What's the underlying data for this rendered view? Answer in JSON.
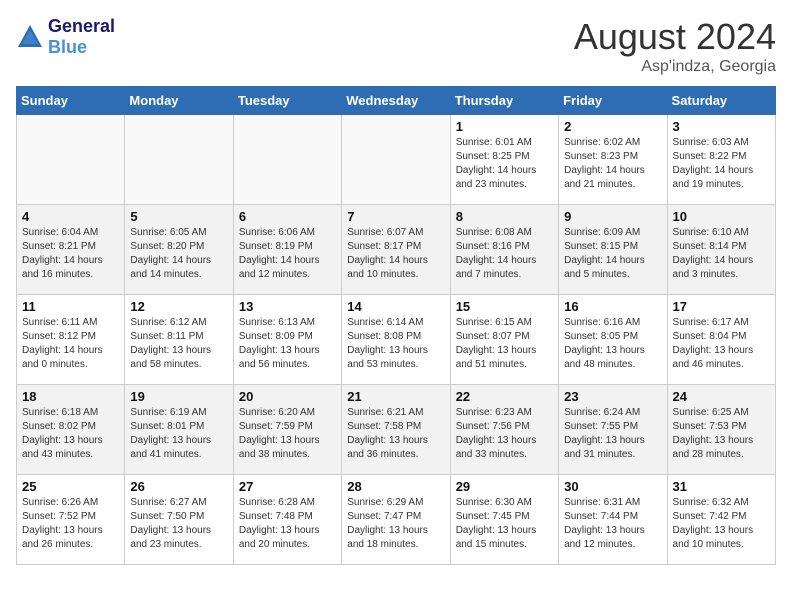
{
  "header": {
    "logo_general": "General",
    "logo_blue": "Blue",
    "month_year": "August 2024",
    "location": "Asp'indza, Georgia"
  },
  "days_of_week": [
    "Sunday",
    "Monday",
    "Tuesday",
    "Wednesday",
    "Thursday",
    "Friday",
    "Saturday"
  ],
  "weeks": [
    [
      {
        "day": "",
        "text": ""
      },
      {
        "day": "",
        "text": ""
      },
      {
        "day": "",
        "text": ""
      },
      {
        "day": "",
        "text": ""
      },
      {
        "day": "1",
        "text": "Sunrise: 6:01 AM\nSunset: 8:25 PM\nDaylight: 14 hours\nand 23 minutes."
      },
      {
        "day": "2",
        "text": "Sunrise: 6:02 AM\nSunset: 8:23 PM\nDaylight: 14 hours\nand 21 minutes."
      },
      {
        "day": "3",
        "text": "Sunrise: 6:03 AM\nSunset: 8:22 PM\nDaylight: 14 hours\nand 19 minutes."
      }
    ],
    [
      {
        "day": "4",
        "text": "Sunrise: 6:04 AM\nSunset: 8:21 PM\nDaylight: 14 hours\nand 16 minutes."
      },
      {
        "day": "5",
        "text": "Sunrise: 6:05 AM\nSunset: 8:20 PM\nDaylight: 14 hours\nand 14 minutes."
      },
      {
        "day": "6",
        "text": "Sunrise: 6:06 AM\nSunset: 8:19 PM\nDaylight: 14 hours\nand 12 minutes."
      },
      {
        "day": "7",
        "text": "Sunrise: 6:07 AM\nSunset: 8:17 PM\nDaylight: 14 hours\nand 10 minutes."
      },
      {
        "day": "8",
        "text": "Sunrise: 6:08 AM\nSunset: 8:16 PM\nDaylight: 14 hours\nand 7 minutes."
      },
      {
        "day": "9",
        "text": "Sunrise: 6:09 AM\nSunset: 8:15 PM\nDaylight: 14 hours\nand 5 minutes."
      },
      {
        "day": "10",
        "text": "Sunrise: 6:10 AM\nSunset: 8:14 PM\nDaylight: 14 hours\nand 3 minutes."
      }
    ],
    [
      {
        "day": "11",
        "text": "Sunrise: 6:11 AM\nSunset: 8:12 PM\nDaylight: 14 hours\nand 0 minutes."
      },
      {
        "day": "12",
        "text": "Sunrise: 6:12 AM\nSunset: 8:11 PM\nDaylight: 13 hours\nand 58 minutes."
      },
      {
        "day": "13",
        "text": "Sunrise: 6:13 AM\nSunset: 8:09 PM\nDaylight: 13 hours\nand 56 minutes."
      },
      {
        "day": "14",
        "text": "Sunrise: 6:14 AM\nSunset: 8:08 PM\nDaylight: 13 hours\nand 53 minutes."
      },
      {
        "day": "15",
        "text": "Sunrise: 6:15 AM\nSunset: 8:07 PM\nDaylight: 13 hours\nand 51 minutes."
      },
      {
        "day": "16",
        "text": "Sunrise: 6:16 AM\nSunset: 8:05 PM\nDaylight: 13 hours\nand 48 minutes."
      },
      {
        "day": "17",
        "text": "Sunrise: 6:17 AM\nSunset: 8:04 PM\nDaylight: 13 hours\nand 46 minutes."
      }
    ],
    [
      {
        "day": "18",
        "text": "Sunrise: 6:18 AM\nSunset: 8:02 PM\nDaylight: 13 hours\nand 43 minutes."
      },
      {
        "day": "19",
        "text": "Sunrise: 6:19 AM\nSunset: 8:01 PM\nDaylight: 13 hours\nand 41 minutes."
      },
      {
        "day": "20",
        "text": "Sunrise: 6:20 AM\nSunset: 7:59 PM\nDaylight: 13 hours\nand 38 minutes."
      },
      {
        "day": "21",
        "text": "Sunrise: 6:21 AM\nSunset: 7:58 PM\nDaylight: 13 hours\nand 36 minutes."
      },
      {
        "day": "22",
        "text": "Sunrise: 6:23 AM\nSunset: 7:56 PM\nDaylight: 13 hours\nand 33 minutes."
      },
      {
        "day": "23",
        "text": "Sunrise: 6:24 AM\nSunset: 7:55 PM\nDaylight: 13 hours\nand 31 minutes."
      },
      {
        "day": "24",
        "text": "Sunrise: 6:25 AM\nSunset: 7:53 PM\nDaylight: 13 hours\nand 28 minutes."
      }
    ],
    [
      {
        "day": "25",
        "text": "Sunrise: 6:26 AM\nSunset: 7:52 PM\nDaylight: 13 hours\nand 26 minutes."
      },
      {
        "day": "26",
        "text": "Sunrise: 6:27 AM\nSunset: 7:50 PM\nDaylight: 13 hours\nand 23 minutes."
      },
      {
        "day": "27",
        "text": "Sunrise: 6:28 AM\nSunset: 7:48 PM\nDaylight: 13 hours\nand 20 minutes."
      },
      {
        "day": "28",
        "text": "Sunrise: 6:29 AM\nSunset: 7:47 PM\nDaylight: 13 hours\nand 18 minutes."
      },
      {
        "day": "29",
        "text": "Sunrise: 6:30 AM\nSunset: 7:45 PM\nDaylight: 13 hours\nand 15 minutes."
      },
      {
        "day": "30",
        "text": "Sunrise: 6:31 AM\nSunset: 7:44 PM\nDaylight: 13 hours\nand 12 minutes."
      },
      {
        "day": "31",
        "text": "Sunrise: 6:32 AM\nSunset: 7:42 PM\nDaylight: 13 hours\nand 10 minutes."
      }
    ]
  ]
}
